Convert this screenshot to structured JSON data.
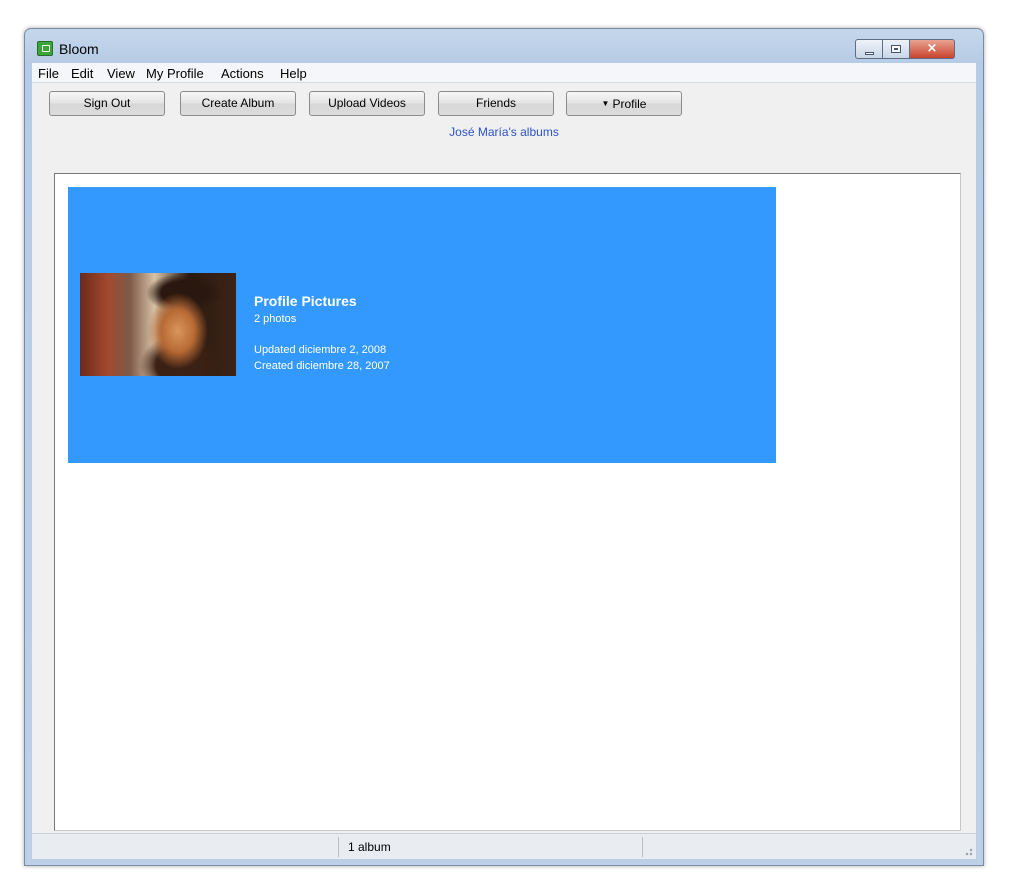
{
  "window": {
    "title": "Bloom",
    "icon": "bloom-app-icon",
    "controls": {
      "minimize_icon": "minimize-icon",
      "maximize_icon": "maximize-icon",
      "close_glyph": "×"
    }
  },
  "menubar": {
    "items": [
      "File",
      "Edit",
      "View",
      "My Profile",
      "Actions",
      "Help"
    ]
  },
  "toolbar": {
    "sign_out_label": "Sign Out",
    "create_album_label": "Create Album",
    "upload_videos_label": "Upload Videos",
    "friends_label": "Friends",
    "profile_arrow": "▼",
    "profile_label": "Profile"
  },
  "header": {
    "albums_title": "José María's albums"
  },
  "albums": [
    {
      "name": "Profile Pictures",
      "count": "2 photos",
      "updated": "Updated diciembre 2, 2008",
      "created": "Created diciembre 28, 2007"
    }
  ],
  "statusbar": {
    "album_count": "1 album"
  },
  "colors": {
    "album_selected_bg": "#3399ff",
    "header_link": "#2c52c8",
    "close_button": "#c8432e"
  }
}
